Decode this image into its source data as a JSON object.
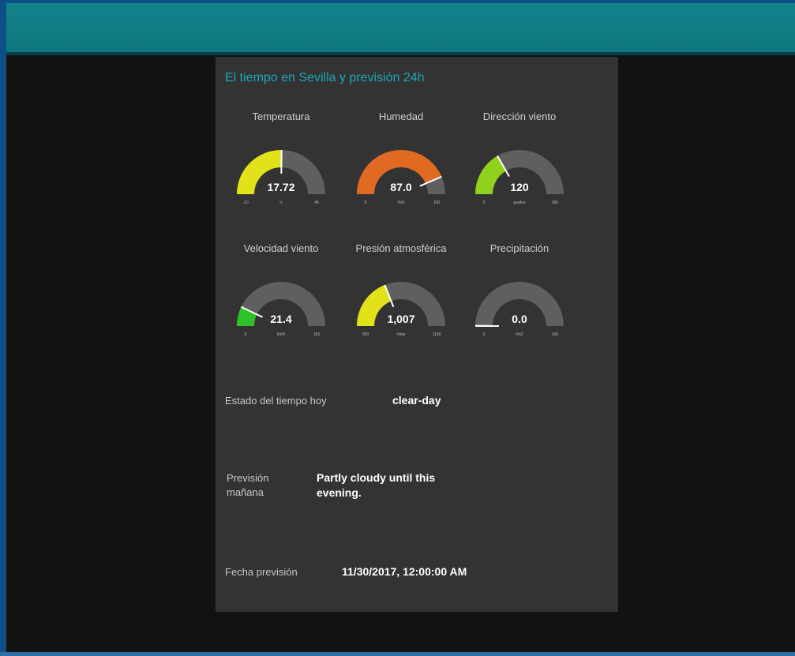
{
  "panel": {
    "title": "El tiempo en Sevilla y previsión 24h"
  },
  "gauges": [
    {
      "title": "Temperatura",
      "value": 17.72,
      "display": "17.72",
      "min": "-10",
      "max": "45",
      "min_num": -10,
      "max_num": 45,
      "unit": "ºc",
      "color": "#e2e21a"
    },
    {
      "title": "Humedad",
      "value": 87.0,
      "display": "87.0",
      "min": "0",
      "max": "100",
      "min_num": 0,
      "max_num": 100,
      "unit": "%rh",
      "color": "#e06a22"
    },
    {
      "title": "Dirección viento",
      "value": 120,
      "display": "120",
      "min": "0",
      "max": "360",
      "min_num": 0,
      "max_num": 360,
      "unit": "grados",
      "color": "#8fd11c"
    },
    {
      "title": "Velocidad viento",
      "value": 21.4,
      "display": "21.4",
      "min": "0",
      "max": "150",
      "min_num": 0,
      "max_num": 150,
      "unit": "km/h",
      "color": "#2fc12a"
    },
    {
      "title": "Presión atmosférica",
      "value": 1007,
      "display": "1,007",
      "min": "950",
      "max": "1100",
      "min_num": 950,
      "max_num": 1100,
      "unit": "mbar",
      "color": "#e2e21a"
    },
    {
      "title": "Precipitación",
      "value": 0.0,
      "display": "0.0",
      "min": "0",
      "max": "100",
      "min_num": 0,
      "max_num": 100,
      "unit": "l/m2",
      "color": "#9c9c9c"
    }
  ],
  "estado": {
    "label": "Estado del tiempo hoy",
    "value": "clear-day"
  },
  "prevision": {
    "label": "Previsión mañana",
    "value": "Partly cloudy until this evening."
  },
  "fecha": {
    "label": "Fecha previsión",
    "value": "11/30/2017, 12:00:00 AM"
  },
  "colors": {
    "header": "#13838c",
    "panel": "#333333",
    "title": "#1ea7b8",
    "track": "#5f5f5f",
    "needle": "#ffffff"
  }
}
